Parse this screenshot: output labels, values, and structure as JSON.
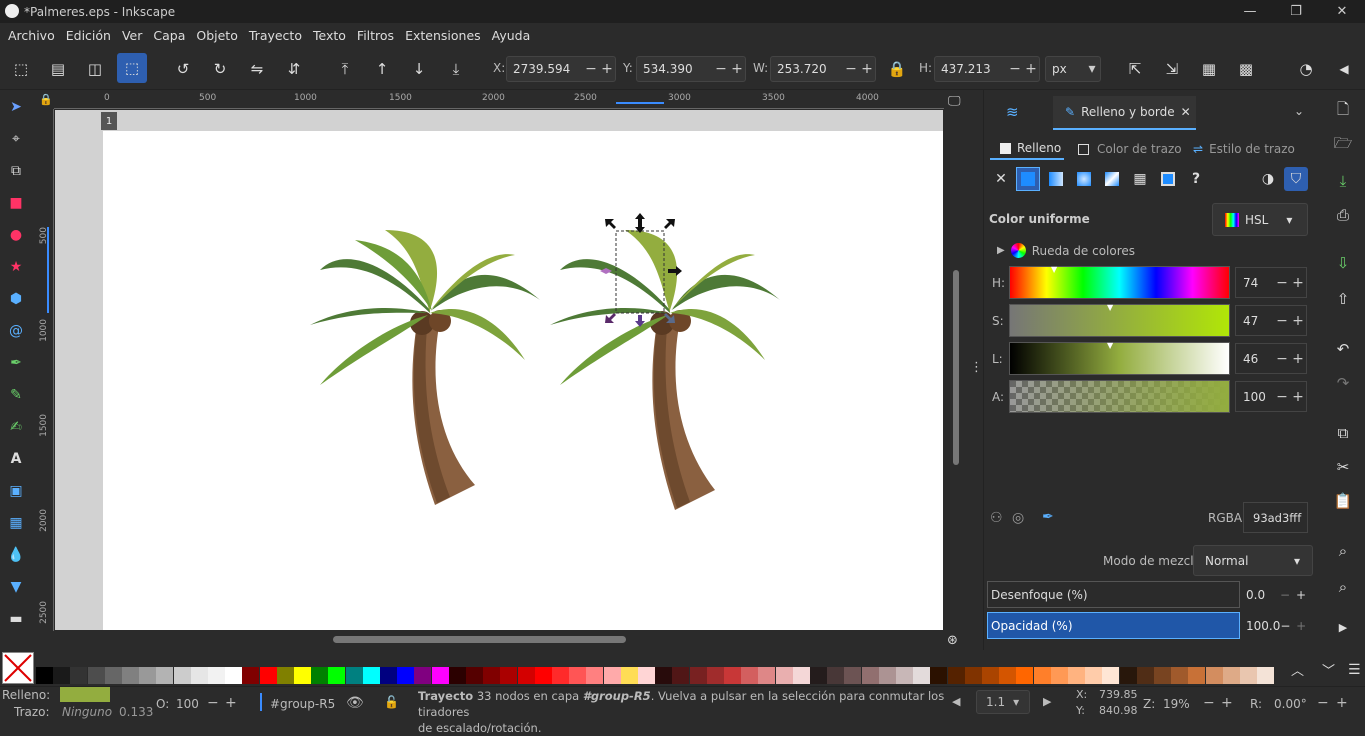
{
  "window": {
    "title": "*Palmeres.eps - Inkscape"
  },
  "menu": [
    "Archivo",
    "Edición",
    "Ver",
    "Capa",
    "Objeto",
    "Trayecto",
    "Texto",
    "Filtros",
    "Extensiones",
    "Ayuda"
  ],
  "coords": {
    "x_label": "X:",
    "x": "2739.594",
    "y_label": "Y:",
    "y": "534.390",
    "w_label": "W:",
    "w": "253.720",
    "h_label": "H:",
    "h": "437.213",
    "unit": "px"
  },
  "ruler_h": [
    "0",
    "500",
    "1000",
    "1500",
    "2000",
    "2500",
    "3000",
    "3500",
    "4000"
  ],
  "ruler_v": [
    "500",
    "1000",
    "1500",
    "2000",
    "2500"
  ],
  "page_number": "1",
  "panel": {
    "tab_label": "Relleno y borde",
    "subtabs": [
      "Relleno",
      "Color de trazo",
      "Estilo de trazo"
    ],
    "fill_mode": "Color uniforme",
    "color_model": "HSL",
    "wheel_label": "Rueda de colores",
    "h_label": "H:",
    "h_val": "74",
    "s_label": "S:",
    "s_val": "47",
    "l_label": "L:",
    "l_val": "46",
    "a_label": "A:",
    "a_val": "100",
    "rgba_label": "RGBA:",
    "rgba": "93ad3fff",
    "blend_label": "Modo de mezcla:",
    "blend": "Normal",
    "blur_label": "Desenfoque (%)",
    "blur": "0.0",
    "opacity_label": "Opacidad (%)",
    "opacity": "100.0"
  },
  "colors": {
    "fill": "#93ad3f",
    "accent": "#2e5fb0"
  },
  "status": {
    "fill_label": "Relleno:",
    "stroke_label": "Trazo:",
    "stroke": "Ninguno",
    "stroke_width": "0.133",
    "o_label": "O:",
    "opacity": "100",
    "layer": "#group-R5",
    "msg_bold": "Trayecto",
    "msg1": " 33 nodos en capa ",
    "msg_layer": "#group-R5",
    "msg2": ". Vuelva a pulsar en la selección para conmutar los tiradores",
    "msg3": "de escalado/rotación.",
    "page_sel": "1.1",
    "cx_label": "X:",
    "cx": "739.85",
    "cy_label": "Y:",
    "cy": "840.98",
    "z_label": "Z:",
    "zoom": "19%",
    "r_label": "R:",
    "rotation": "0.00°"
  }
}
